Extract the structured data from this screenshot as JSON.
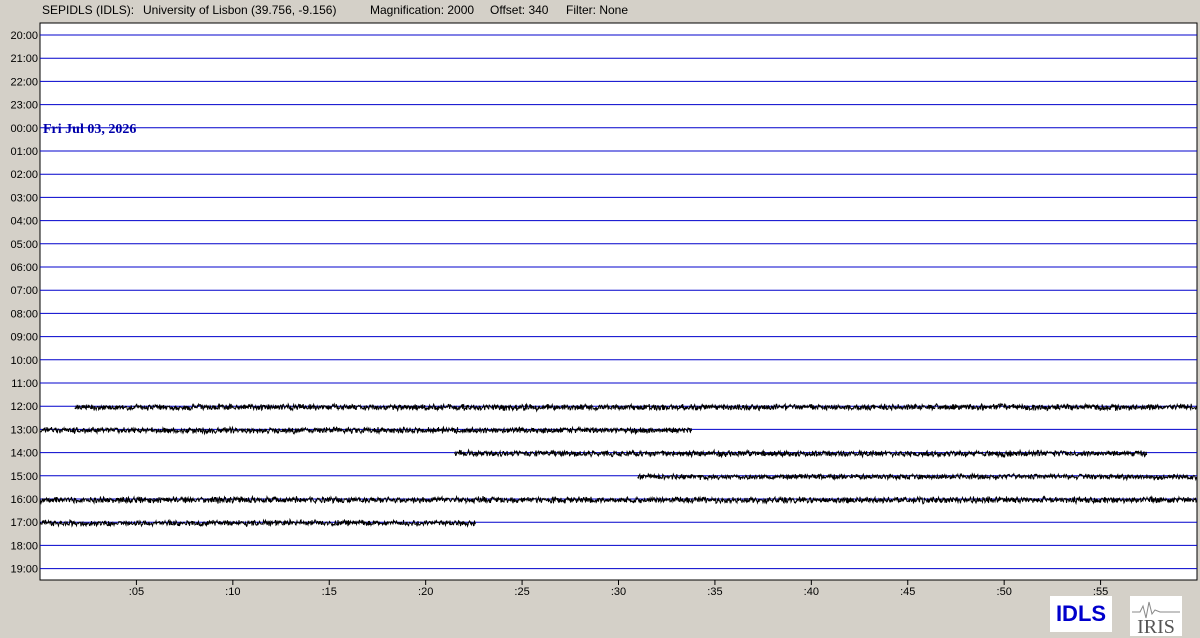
{
  "header": {
    "station": "SEPIDLS (IDLS):",
    "location": "University of Lisbon (39.756, -9.156)",
    "magnification": "Magnification: 2000",
    "offset": "Offset: 340",
    "filter": "Filter: None"
  },
  "colors": {
    "background": "#d4d0c8",
    "plot_background": "#ffffff",
    "grid_line": "#0000cc",
    "trace": "#000000",
    "date_label": "#0000aa"
  },
  "logos": {
    "idls": "IDLS",
    "iris": "IRIS"
  },
  "chart_data": {
    "type": "helicorder",
    "date_label": "Fri Jul 03, 2026",
    "date_label_row": "00:00",
    "row_labels": [
      "20:00",
      "21:00",
      "22:00",
      "23:00",
      "00:00",
      "01:00",
      "02:00",
      "03:00",
      "04:00",
      "05:00",
      "06:00",
      "07:00",
      "08:00",
      "09:00",
      "10:00",
      "11:00",
      "12:00",
      "13:00",
      "14:00",
      "15:00",
      "16:00",
      "17:00",
      "18:00",
      "19:00"
    ],
    "x_ticks": [
      ":05",
      ":10",
      ":15",
      ":20",
      ":25",
      ":30",
      ":35",
      ":40",
      ":45",
      ":50",
      ":55"
    ],
    "x_tick_minutes": [
      5,
      10,
      15,
      20,
      25,
      30,
      35,
      40,
      45,
      50,
      55
    ],
    "x_range_minutes": [
      0,
      60
    ],
    "traces": [
      {
        "row": "12:00",
        "start_min": 1.8,
        "end_min": 60,
        "amplitude": 2.5
      },
      {
        "row": "13:00",
        "start_min": 0,
        "end_min": 33.8,
        "amplitude": 2.5
      },
      {
        "row": "14:00",
        "start_min": 21.5,
        "end_min": 57.4,
        "amplitude": 2.5
      },
      {
        "row": "15:00",
        "start_min": 31,
        "end_min": 60,
        "amplitude": 2.2
      },
      {
        "row": "16:00",
        "start_min": 0,
        "end_min": 60,
        "amplitude": 2.6
      },
      {
        "row": "17:00",
        "start_min": 0,
        "end_min": 22.6,
        "amplitude": 2.4
      }
    ]
  }
}
